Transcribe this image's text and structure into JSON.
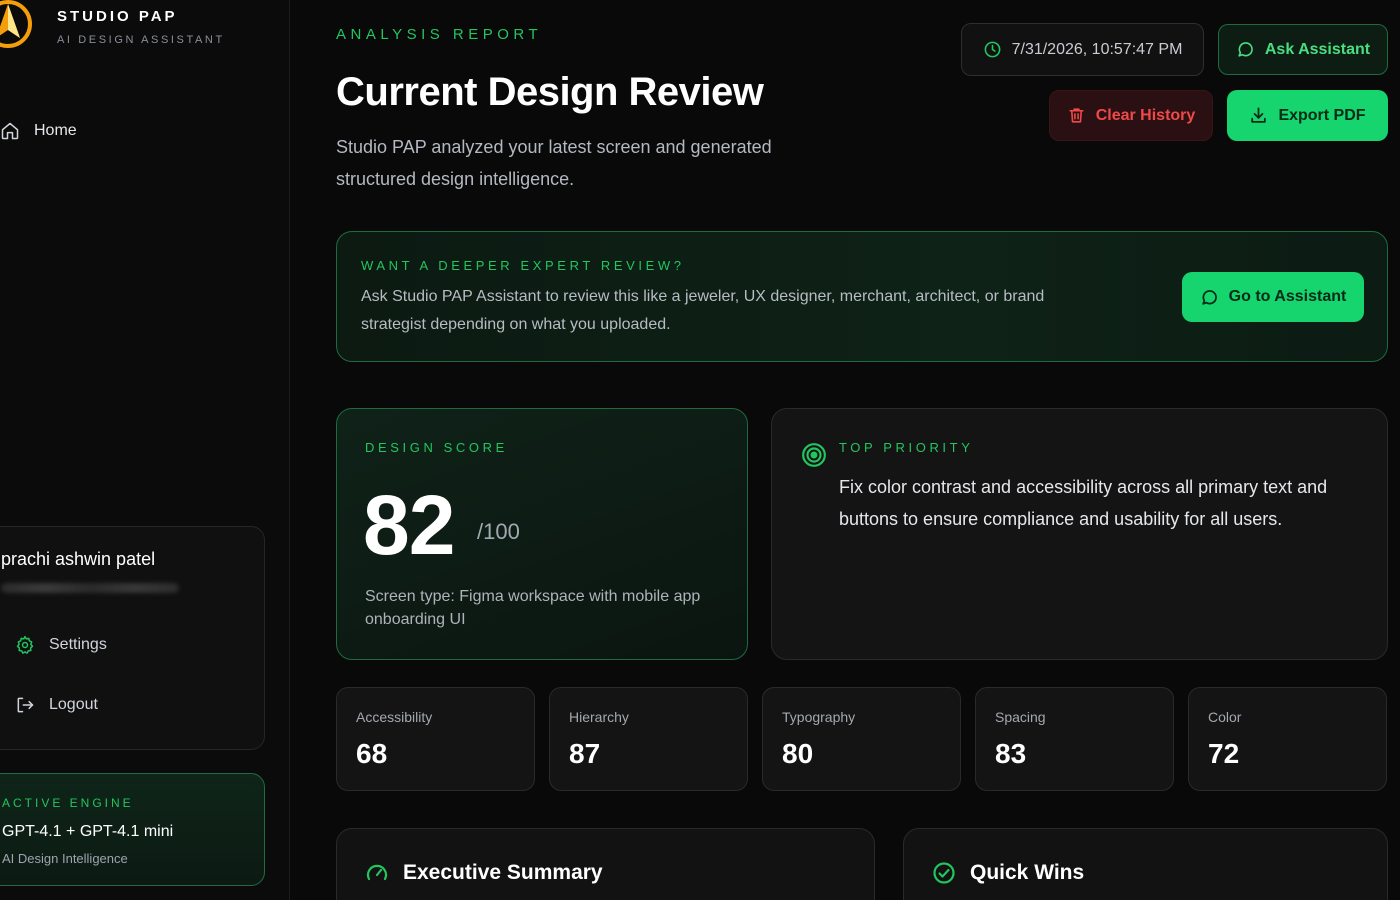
{
  "brand": {
    "name": "STUDIO PAP",
    "tagline": "AI DESIGN ASSISTANT",
    "logo_icon": "studio-pap-logo"
  },
  "sidebar": {
    "nav": [
      {
        "label": "Home",
        "icon": "home-icon"
      }
    ],
    "user": {
      "name": "prachi ashwin patel",
      "menu": [
        {
          "label": "Settings",
          "icon": "gear-icon"
        },
        {
          "label": "Logout",
          "icon": "logout-icon"
        }
      ]
    },
    "engine": {
      "label": "ACTIVE ENGINE",
      "name": "GPT-4.1 + GPT-4.1 mini",
      "subtitle": "AI Design Intelligence"
    }
  },
  "header": {
    "eyebrow": "ANALYSIS REPORT",
    "title": "Current Design Review",
    "description": "Studio PAP analyzed your latest screen and generated structured design intelligence.",
    "timestamp": "7/31/2026, 10:57:47 PM",
    "ask_label": "Ask Assistant",
    "clear_label": "Clear History",
    "export_label": "Export PDF"
  },
  "expert_banner": {
    "eyebrow": "WANT A DEEPER EXPERT REVIEW?",
    "text": "Ask Studio PAP Assistant to review this like a jeweler, UX designer, merchant, architect, or brand strategist depending on what you uploaded.",
    "button_label": "Go to Assistant"
  },
  "score": {
    "label": "DESIGN SCORE",
    "value": "82",
    "max": "/100",
    "screen_type": "Screen type: Figma workspace with mobile app onboarding UI"
  },
  "priority": {
    "label": "TOP PRIORITY",
    "text": "Fix color contrast and accessibility across all primary text and buttons to ensure compliance and usability for all users."
  },
  "metrics": [
    {
      "name": "Accessibility",
      "value": "68"
    },
    {
      "name": "Hierarchy",
      "value": "87"
    },
    {
      "name": "Typography",
      "value": "80"
    },
    {
      "name": "Spacing",
      "value": "83"
    },
    {
      "name": "Color",
      "value": "72"
    }
  ],
  "sections": [
    {
      "title": "Executive Summary",
      "icon": "gauge-icon"
    },
    {
      "title": "Quick Wins",
      "icon": "check-circle-icon"
    }
  ],
  "colors": {
    "accent": "#16d46e",
    "accent_text": "#22c55e",
    "danger": "#f04949",
    "background": "#090909"
  }
}
